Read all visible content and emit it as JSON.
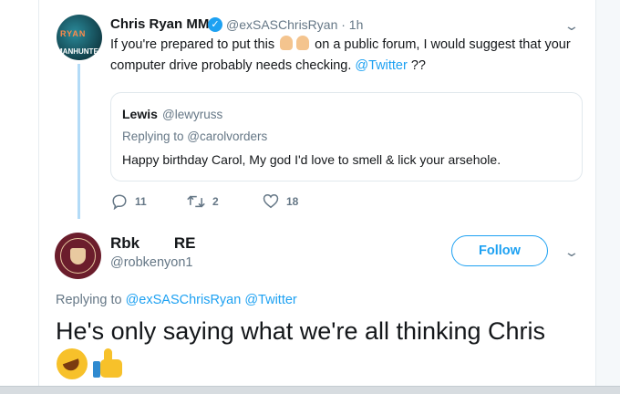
{
  "tweet1": {
    "display_name": "Chris Ryan MM",
    "handle_time": "@exSASChrisRyan · 1h",
    "avatar_text": "RYAN",
    "avatar_subtext": "MANHUNTER",
    "text_line1_start": "If you're prepared to put this",
    "text_line1_end": "on a public forum, I would suggest that your",
    "text_line2_start": "computer drive probably needs checking.",
    "text_mention": "@Twitter",
    "text_line2_end": "??",
    "quote": {
      "name": "Lewis",
      "handle": "@lewyruss",
      "replying_to": "Replying to @carolvorders",
      "text": "Happy birthday Carol, My god I'd love to smell & lick your arsehole."
    },
    "actions": {
      "replies": "11",
      "retweets": "2",
      "likes": "18"
    }
  },
  "tweet2": {
    "display_name": "Rbk        RE",
    "handle": "@robkenyon1",
    "follow_label": "Follow",
    "replying_prefix": "Replying to",
    "replying_mentions": "@exSASChrisRyan @Twitter",
    "text": "He's only saying what we're all thinking Chris"
  },
  "colors": {
    "accent": "#1da1f2",
    "secondary_text": "#657786",
    "thread_line": "#b3dbf7"
  },
  "icons": [
    "verified-badge-icon",
    "caret-down-icon",
    "reply-icon",
    "retweet-icon",
    "like-icon",
    "finger-point-down-emoji",
    "rolling-laughing-emoji",
    "thumbs-up-emoji"
  ]
}
